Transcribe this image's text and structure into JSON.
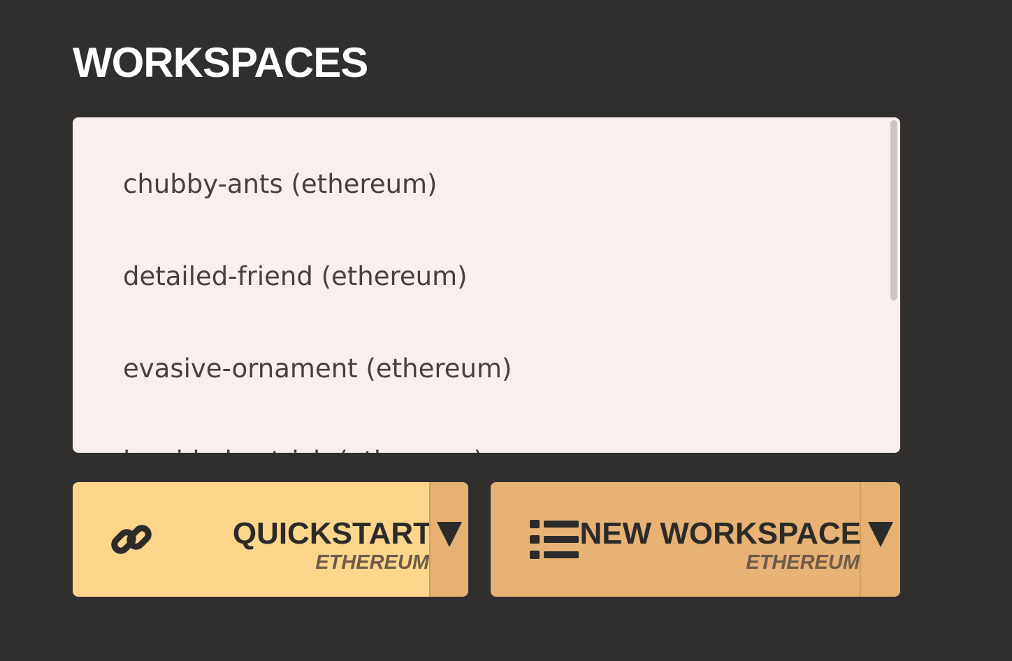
{
  "page": {
    "title": "WORKSPACES"
  },
  "workspaces": {
    "items": [
      {
        "label": "chubby-ants (ethereum)"
      },
      {
        "label": "detailed-friend (ethereum)"
      },
      {
        "label": "evasive-ornament (ethereum)"
      },
      {
        "label": "lopsided-ostrich (ethereum)"
      }
    ]
  },
  "actions": {
    "quickstart": {
      "label": "QUICKSTART",
      "sublabel": "ETHEREUM",
      "icon": "link-icon"
    },
    "new_workspace": {
      "label": "NEW WORKSPACE",
      "sublabel": "ETHEREUM",
      "icon": "list-icon"
    },
    "dropdown_icon": "caret-down-icon"
  },
  "colors": {
    "background": "#302f2d",
    "panel": "#f9f0ed",
    "list_text": "#4a3e3e",
    "quickstart_button": "#fed68b",
    "new_workspace_button": "#e7b274",
    "caret_area": "#e6b173",
    "button_text": "#2c2b29"
  }
}
